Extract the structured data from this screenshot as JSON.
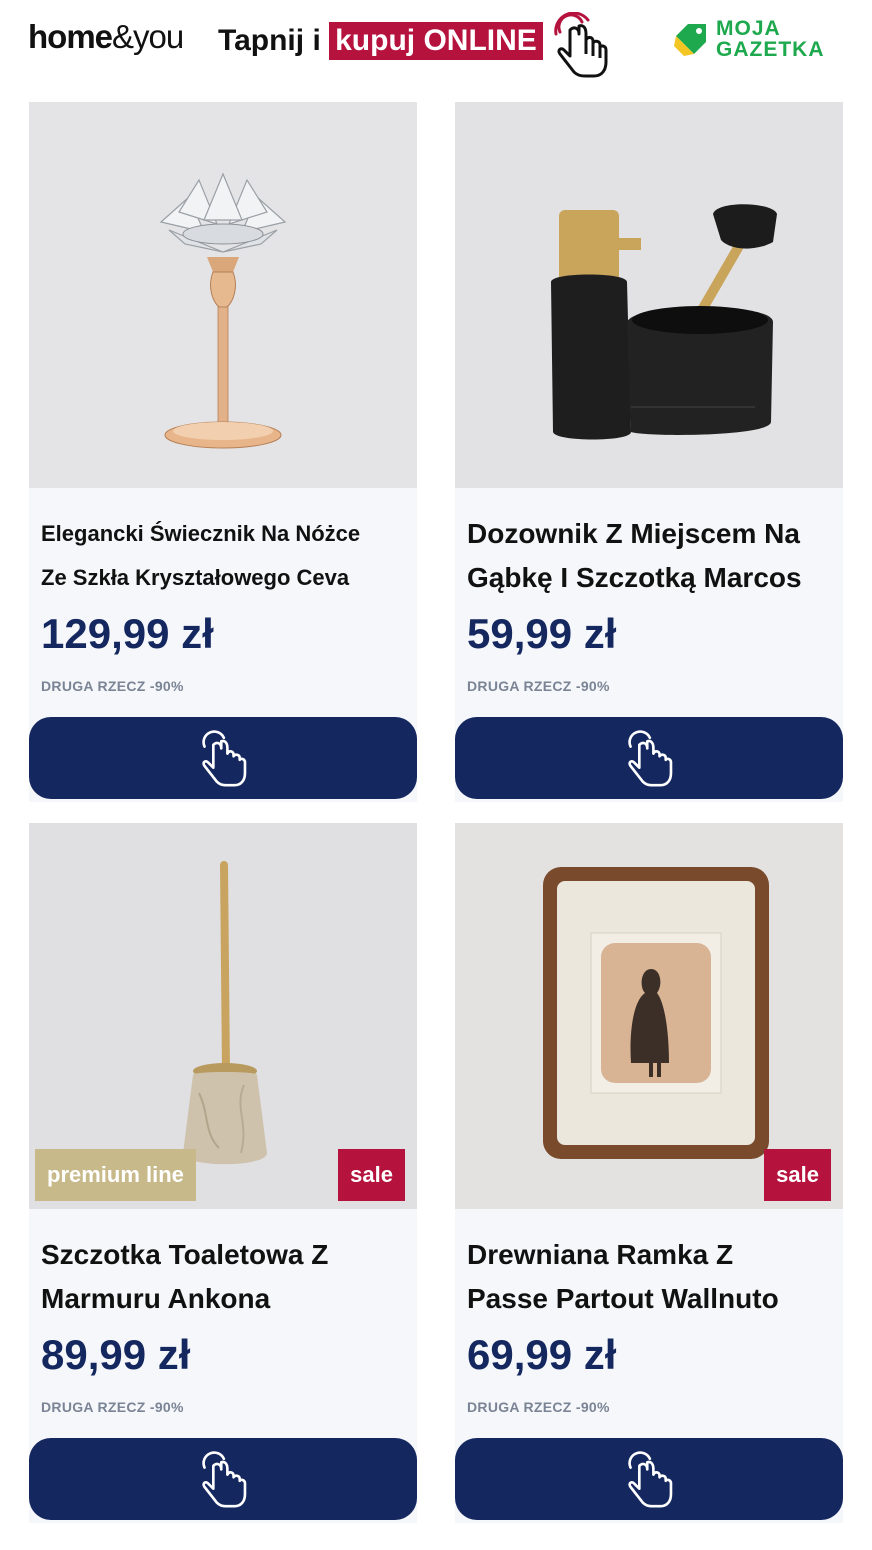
{
  "header": {
    "logo_bold": "home",
    "logo_light": "&you",
    "tap_prefix": "Tapnij i",
    "tap_highlight": "kupuj ONLINE",
    "moja_line1": "MOJA",
    "moja_line2": "GAZETKA"
  },
  "colors": {
    "accent_red": "#b5123d",
    "navy": "#14275f",
    "green": "#1fa94e",
    "premium_gold": "#c7b98a"
  },
  "products": [
    {
      "title_line1": "Elegancki Świecznik Na Nóżce",
      "title_line2": "Ze Szkła Kryształowego Ceva",
      "price": "129,99 zł",
      "note": "DRUGA RZECZ -90%"
    },
    {
      "title_line1": "Dozownik Z Miejscem Na",
      "title_line2": "Gąbkę I Szczotką Marcos",
      "price": "59,99 zł",
      "note": "DRUGA RZECZ -90%"
    },
    {
      "title_line1": "Szczotka Toaletowa Z",
      "title_line2": "Marmuru Ankona",
      "price": "89,99 zł",
      "note": "DRUGA RZECZ -90%",
      "badge_left": "premium line",
      "badge_right": "sale"
    },
    {
      "title_line1": "Drewniana Ramka Z",
      "title_line2": "Passe Partout Wallnuto",
      "price": "69,99 zł",
      "note": "DRUGA RZECZ -90%",
      "badge_right": "sale"
    }
  ],
  "icons": {
    "tap_hand": "pointing-hand-icon",
    "logo_tag": "price-tag-icon"
  }
}
